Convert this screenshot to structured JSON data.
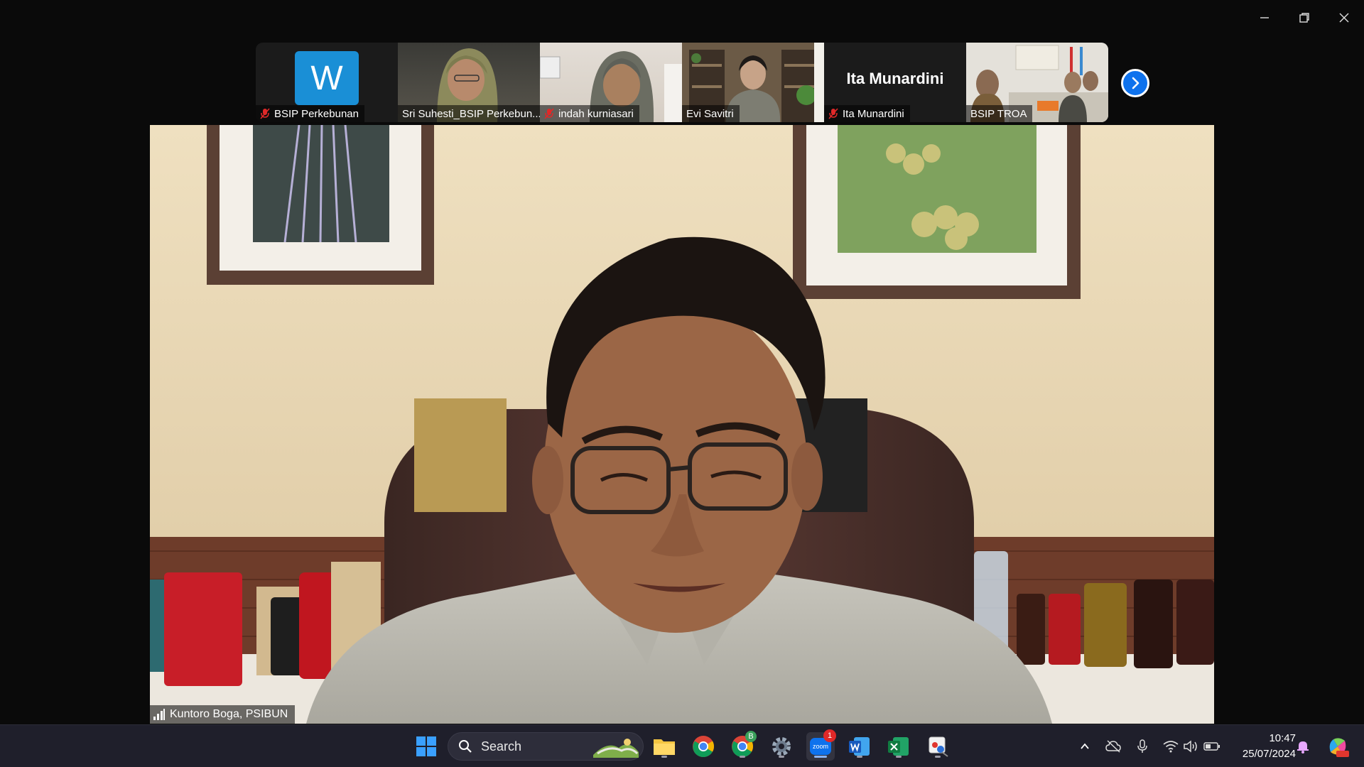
{
  "window": {
    "minimize_icon": "minimize-icon",
    "restore_icon": "restore-icon",
    "close_icon": "close-icon"
  },
  "participants": [
    {
      "name": "BSIP Perkebunan",
      "muted": true,
      "avatar_letter": "W"
    },
    {
      "name": "Sri Suhesti_BSIP Perkebun...",
      "muted": false
    },
    {
      "name": "indah kurniasari",
      "muted": true
    },
    {
      "name": "Evi Savitri",
      "muted": false
    },
    {
      "name": "Ita Munardini",
      "muted": true,
      "display_name": "Ita Munardini"
    },
    {
      "name": "BSIP TROA",
      "muted": false
    }
  ],
  "main": {
    "speaker_name": "Kuntoro Boga, PSIBUN"
  },
  "taskbar": {
    "search_label": "Search",
    "chrome_badge": "B",
    "zoom_badge": "1",
    "zoom_label": "zoom",
    "time": "10:47",
    "date": "25/07/2024"
  },
  "colors": {
    "zoom_blue": "#0e72ed",
    "avatar_blue": "#1a8fd6",
    "mute_red": "#e02828",
    "taskbar_bg": "#1f1f2b"
  }
}
